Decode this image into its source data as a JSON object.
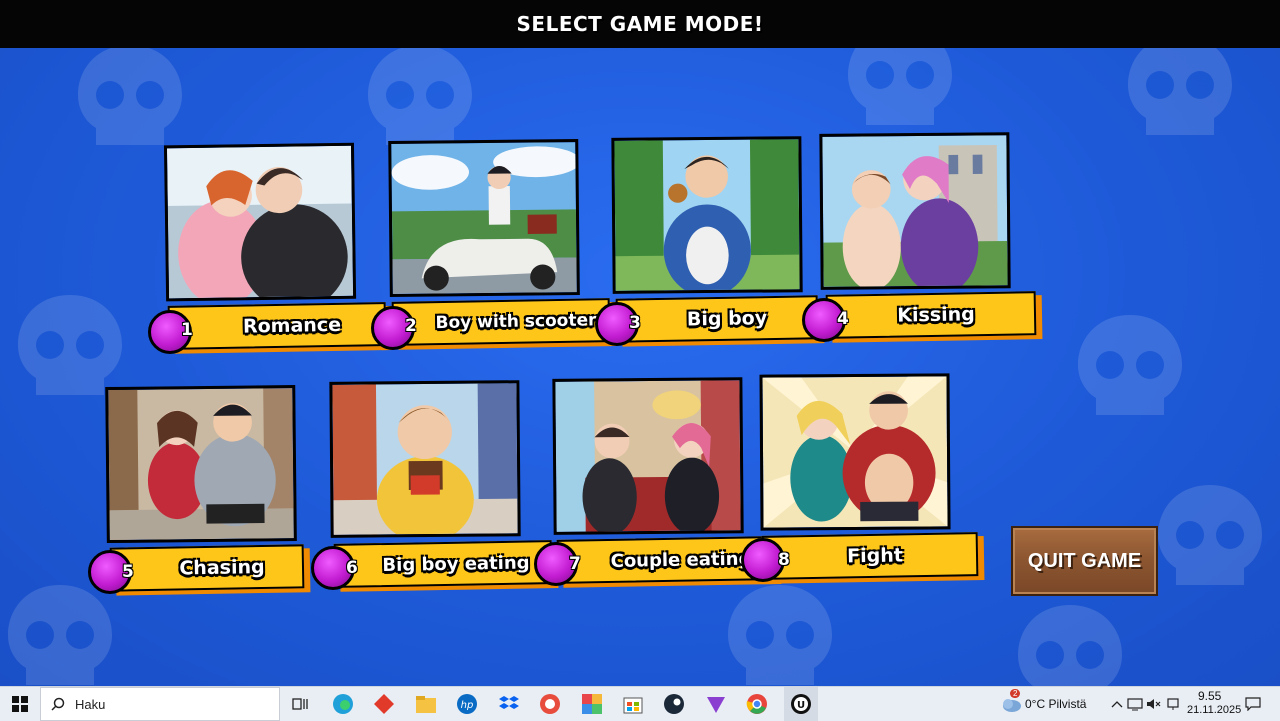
{
  "header": {
    "title": "SELECT GAME MODE!"
  },
  "modes": [
    {
      "number": "1",
      "label": "Romance"
    },
    {
      "number": "2",
      "label": "Boy with scooter"
    },
    {
      "number": "3",
      "label": "Big boy"
    },
    {
      "number": "4",
      "label": "Kissing"
    },
    {
      "number": "5",
      "label": "Chasing"
    },
    {
      "number": "6",
      "label": "Big boy eating"
    },
    {
      "number": "7",
      "label": "Couple eating"
    },
    {
      "number": "8",
      "label": "Fight"
    }
  ],
  "quit": {
    "label": "QUIT GAME"
  },
  "taskbar": {
    "search_placeholder": "Haku",
    "weather": "0°C  Pilvistä",
    "weather_badge": "2",
    "time": "9.55",
    "date": "21.11.2025",
    "icons": [
      "windows-start-icon",
      "search-icon",
      "task-view-icon",
      "edge-icon",
      "app-red-icon",
      "file-explorer-icon",
      "hp-icon",
      "dropbox-icon",
      "app-orange-icon",
      "app-colorful-icon",
      "store-icon",
      "steam-icon",
      "app-purple-icon",
      "chrome-icon",
      "unreal-engine-icon"
    ]
  },
  "colors": {
    "background": "#1f5fd6",
    "banner": "#ffc61a",
    "banner_shadow": "#f08a00",
    "badge": "#c21cd1",
    "topbar": "#050505"
  }
}
